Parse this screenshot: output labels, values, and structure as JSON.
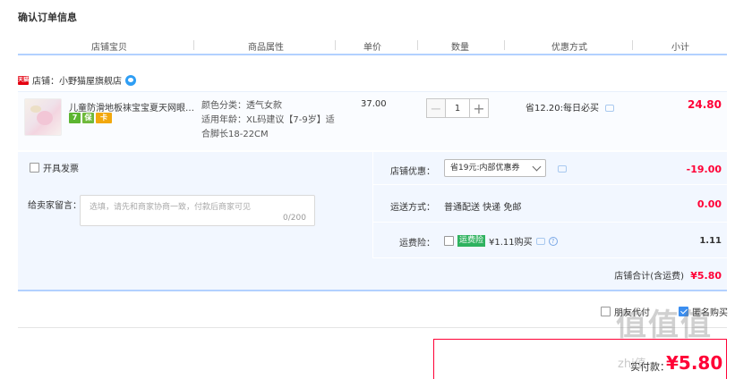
{
  "page": {
    "title": "确认订单信息"
  },
  "columns": [
    "店铺宝贝",
    "商品属性",
    "单价",
    "数量",
    "优惠方式",
    "小计"
  ],
  "shop": {
    "badge": "天猫",
    "name": "店铺：小野猫屋旗舰店"
  },
  "item": {
    "title": "儿童防滑地板袜宝宝夏天网眼透...",
    "service_icons": [
      "7",
      "保",
      "卡"
    ],
    "attr_color": "颜色分类：透气女款",
    "attr_age_1": "适用年龄：XL码建议【7-9岁】适",
    "attr_age_2": "合脚长18-22CM",
    "price": "37.00",
    "quantity": "1",
    "promo": "省12.20:每日必买",
    "subtotal": "24.80"
  },
  "invoice": {
    "label": "开具发票"
  },
  "message": {
    "label": "给卖家留言：",
    "placeholder": "选填，请先和商家协商一致，付款后商家可见",
    "count": "0/200"
  },
  "shop_coupon": {
    "label": "店铺优惠：",
    "selected": "省19元:内部优惠券",
    "amount": "-19.00"
  },
  "shipping": {
    "label": "运送方式：",
    "value": "普通配送 快递 免邮",
    "amount": "0.00"
  },
  "insurance": {
    "label": "运费险：",
    "badge": "运费险",
    "value": "¥1.11购买",
    "amount": "1.11"
  },
  "shop_total": {
    "label": "店铺合计(含运费)",
    "amount": "¥5.80"
  },
  "options": {
    "friend_pay": "朋友代付",
    "anonymous": "匿名购买"
  },
  "payment": {
    "label": "实付款：",
    "amount": "¥5.80"
  },
  "watermark": {
    "text": "值值值",
    "url": "zhi值"
  },
  "colors": {
    "accent": "#ff0036",
    "panel": "#f2f7ff",
    "line": "#b2d1ff"
  }
}
